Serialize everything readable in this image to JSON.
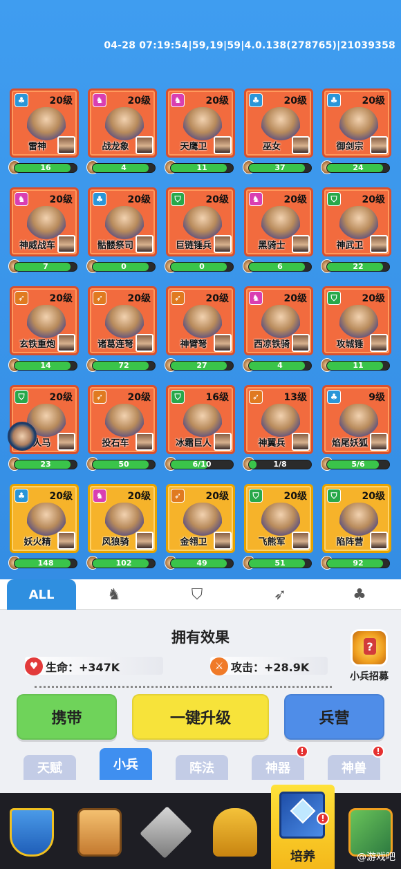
{
  "debug_line": "04-28 07:19:54|59,19|59|4.0.138(278765)|21039358",
  "units": [
    {
      "type": "magic",
      "level": "20级",
      "name": "雷神",
      "progress": "16",
      "fill": 0.9,
      "gold": false
    },
    {
      "type": "horse",
      "level": "20级",
      "name": "战龙象",
      "progress": "4",
      "fill": 0.9,
      "gold": false
    },
    {
      "type": "horse",
      "level": "20级",
      "name": "天鹰卫",
      "progress": "11",
      "fill": 0.9,
      "gold": false
    },
    {
      "type": "magic",
      "level": "20级",
      "name": "巫女",
      "progress": "37",
      "fill": 0.9,
      "gold": false
    },
    {
      "type": "magic",
      "level": "20级",
      "name": "御剑宗",
      "progress": "24",
      "fill": 0.9,
      "gold": false
    },
    {
      "type": "horse",
      "level": "20级",
      "name": "神威战车",
      "progress": "7",
      "fill": 0.9,
      "gold": false
    },
    {
      "type": "magic",
      "level": "20级",
      "name": "骷髅祭司",
      "progress": "0",
      "fill": 0.9,
      "gold": false
    },
    {
      "type": "shield",
      "level": "20级",
      "name": "巨链锤兵",
      "progress": "0",
      "fill": 0.9,
      "gold": false
    },
    {
      "type": "horse",
      "level": "20级",
      "name": "黑骑士",
      "progress": "6",
      "fill": 0.9,
      "gold": false
    },
    {
      "type": "shield",
      "level": "20级",
      "name": "神武卫",
      "progress": "22",
      "fill": 0.9,
      "gold": false
    },
    {
      "type": "bow",
      "level": "20级",
      "name": "玄铁重炮",
      "progress": "14",
      "fill": 0.9,
      "gold": false
    },
    {
      "type": "bow",
      "level": "20级",
      "name": "诸葛连弩",
      "progress": "72",
      "fill": 0.9,
      "gold": false
    },
    {
      "type": "bow",
      "level": "20级",
      "name": "神臂弩",
      "progress": "27",
      "fill": 0.9,
      "gold": false
    },
    {
      "type": "horse",
      "level": "20级",
      "name": "西凉铁骑",
      "progress": "4",
      "fill": 0.9,
      "gold": false
    },
    {
      "type": "shield",
      "level": "20级",
      "name": "攻城锤",
      "progress": "11",
      "fill": 0.9,
      "gold": false
    },
    {
      "type": "shield",
      "level": "20级",
      "name": "半人马",
      "progress": "23",
      "fill": 0.9,
      "gold": false
    },
    {
      "type": "bow",
      "level": "20级",
      "name": "投石车",
      "progress": "50",
      "fill": 0.9,
      "gold": false
    },
    {
      "type": "shield",
      "level": "16级",
      "name": "冰霜巨人",
      "progress": "6/10",
      "fill": 0.6,
      "gold": false
    },
    {
      "type": "bow",
      "level": "13级",
      "name": "神翼兵",
      "progress": "1/8",
      "fill": 0.125,
      "gold": false
    },
    {
      "type": "magic",
      "level": "9级",
      "name": "焰尾妖狐",
      "progress": "5/6",
      "fill": 0.83,
      "gold": false
    },
    {
      "type": "magic",
      "level": "20级",
      "name": "妖火精",
      "progress": "148",
      "fill": 0.9,
      "gold": true
    },
    {
      "type": "horse",
      "level": "20级",
      "name": "风狼骑",
      "progress": "102",
      "fill": 0.9,
      "gold": true
    },
    {
      "type": "bow",
      "level": "20级",
      "name": "金翎卫",
      "progress": "49",
      "fill": 0.9,
      "gold": true
    },
    {
      "type": "shield",
      "level": "20级",
      "name": "飞熊军",
      "progress": "51",
      "fill": 0.9,
      "gold": true
    },
    {
      "type": "shield",
      "level": "20级",
      "name": "陷阵营",
      "progress": "92",
      "fill": 0.9,
      "gold": true
    }
  ],
  "tabs": {
    "all": "ALL"
  },
  "effect": {
    "title": "拥有效果",
    "hp_label": "生命：+347K",
    "atk_label": "攻击：+28.9K"
  },
  "recruit_label": "小兵招募",
  "buttons": {
    "carry": "携带",
    "upgrade": "一键升级",
    "barracks": "兵营"
  },
  "subtabs": [
    "天赋",
    "小兵",
    "阵法",
    "神器",
    "神兽"
  ],
  "nav": {
    "active_label": "培养"
  },
  "watermark": "@游戏吧",
  "colors": {
    "accent": "#2f8fe0",
    "card_red": "#f26b3e",
    "card_gold": "#f6b32a",
    "progress": "#3ac44a"
  }
}
